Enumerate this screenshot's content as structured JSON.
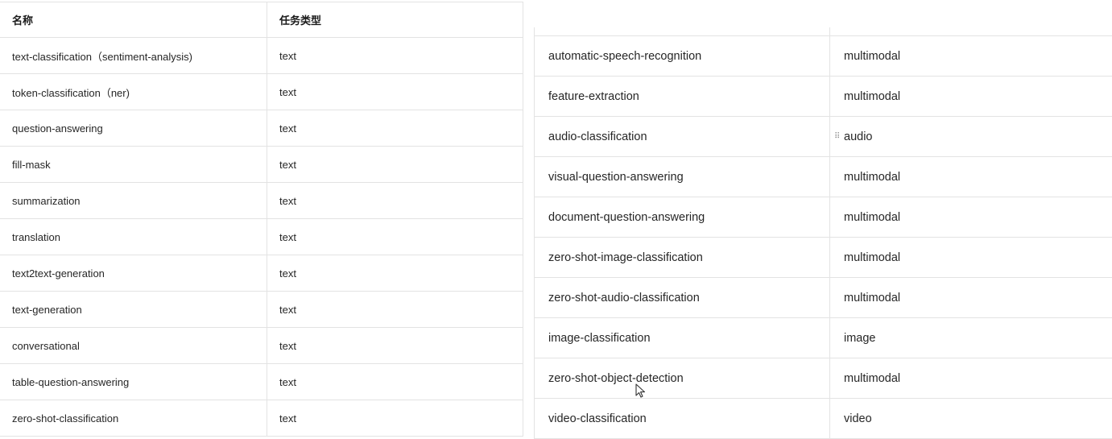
{
  "left_table": {
    "headers": [
      "名称",
      "任务类型"
    ],
    "rows": [
      [
        "text-classification（sentiment-analysis)",
        "text"
      ],
      [
        "token-classification（ner)",
        "text"
      ],
      [
        "question-answering",
        "text"
      ],
      [
        "fill-mask",
        "text"
      ],
      [
        "summarization",
        "text"
      ],
      [
        "translation",
        "text"
      ],
      [
        "text2text-generation",
        "text"
      ],
      [
        "text-generation",
        "text"
      ],
      [
        "conversational",
        "text"
      ],
      [
        "table-question-answering",
        "text"
      ],
      [
        "zero-shot-classification",
        "text"
      ]
    ]
  },
  "right_table": {
    "rows": [
      [
        "automatic-speech-recognition",
        "multimodal"
      ],
      [
        "feature-extraction",
        "multimodal"
      ],
      [
        "audio-classification",
        "audio"
      ],
      [
        "visual-question-answering",
        "multimodal"
      ],
      [
        "document-question-answering",
        "multimodal"
      ],
      [
        "zero-shot-image-classification",
        "multimodal"
      ],
      [
        "zero-shot-audio-classification",
        "multimodal"
      ],
      [
        "image-classification",
        "image"
      ],
      [
        "zero-shot-object-detection",
        "multimodal"
      ],
      [
        "video-classification",
        "video"
      ]
    ]
  },
  "icons": {
    "drag_handle": "drag-handle-icon",
    "cursor": "mouse-pointer-icon"
  },
  "colors": {
    "border": "#e3e3e3",
    "text": "#262626"
  }
}
